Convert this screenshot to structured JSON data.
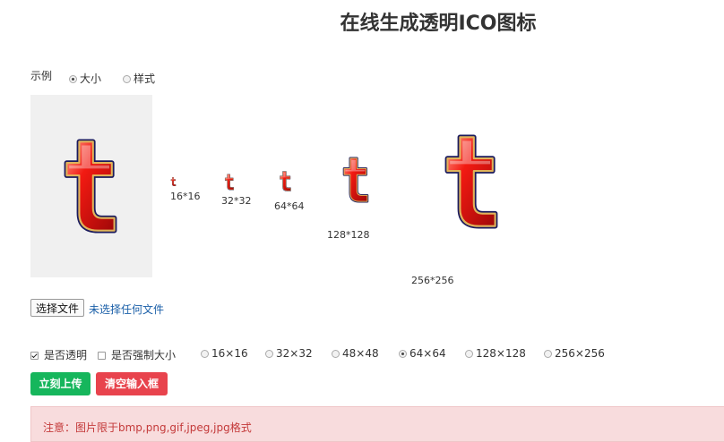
{
  "page": {
    "title": "在线生成透明ICO图标"
  },
  "example": {
    "label": "示例",
    "options": [
      {
        "label": "大小",
        "selected": true
      },
      {
        "label": "样式",
        "selected": false
      }
    ]
  },
  "preview": {
    "icon": "letter-t-icon",
    "sizes": [
      "16*16",
      "32*32",
      "64*64",
      "128*128",
      "256*256"
    ]
  },
  "file": {
    "button_label": "选择文件",
    "status": "未选择任何文件"
  },
  "options": {
    "transparent": {
      "label": "是否透明",
      "checked": true
    },
    "force_size": {
      "label": "是否强制大小",
      "checked": false
    },
    "sizes": [
      {
        "label": "16×16",
        "selected": false
      },
      {
        "label": "32×32",
        "selected": false
      },
      {
        "label": "48×48",
        "selected": false
      },
      {
        "label": "64×64",
        "selected": true
      },
      {
        "label": "128×128",
        "selected": false
      },
      {
        "label": "256×256",
        "selected": false
      }
    ]
  },
  "actions": {
    "upload_label": "立刻上传",
    "clear_label": "清空输入框"
  },
  "notice": {
    "text": "注意：图片限于bmp,png,gif,jpeg,jpg格式"
  },
  "colors": {
    "accent_green": "#16b65c",
    "accent_red": "#e8434d",
    "notice_bg": "#f8dcdd",
    "link_blue": "#1a5fa8"
  }
}
